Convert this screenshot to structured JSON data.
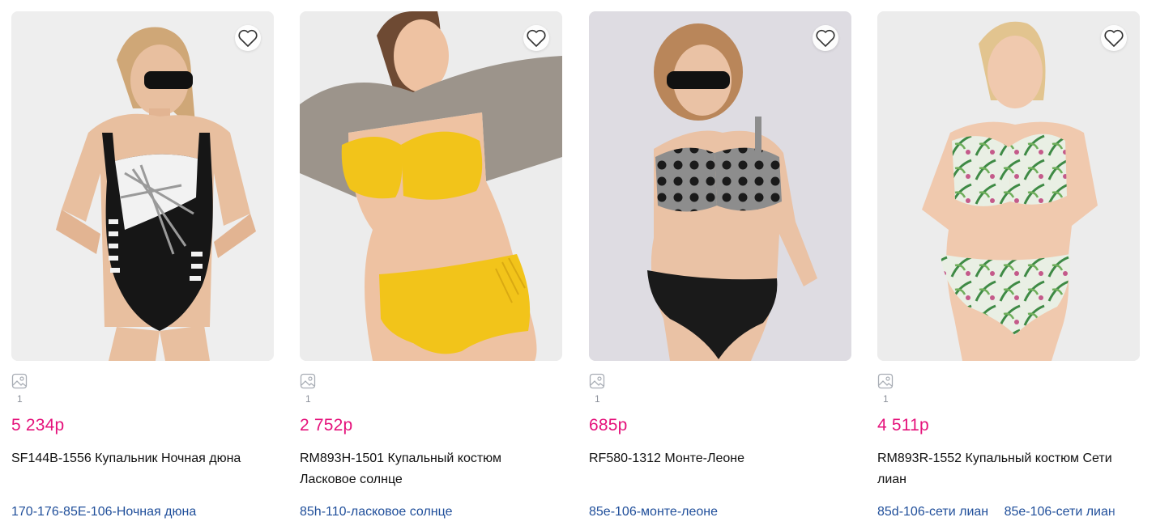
{
  "products": [
    {
      "media_count": "1",
      "price": "5 234р",
      "name": "SF144B-1556 Купальник Ночная дюна",
      "variants": [
        "170-176-85E-106-Ночная дюна"
      ],
      "colors": {
        "bg": "#eeeeee",
        "suit": "#161616",
        "accent": "#f2f2f2",
        "hair": "#cfa777",
        "skin": "#e8bf9f"
      },
      "style": "one-piece"
    },
    {
      "media_count": "1",
      "price": "2 752р",
      "name": "RM893H-1501 Купальный костюм Ласковое солнце",
      "variants": [
        "85h-110-ласковое солнце"
      ],
      "colors": {
        "bg": "#ececec",
        "suit": "#f2c41a",
        "accent": "#9c948b",
        "hair": "#6e4a33",
        "skin": "#eec2a2"
      },
      "style": "bikini-cardigan"
    },
    {
      "media_count": "1",
      "price": "685р",
      "name": "RF580-1312 Монте-Леоне",
      "variants": [
        "85e-106-монте-леоне"
      ],
      "colors": {
        "bg": "#dedce2",
        "suit": "#1a1a1a",
        "accent": "#8d8d8d",
        "hair": "#b9865a",
        "skin": "#eac2a5"
      },
      "style": "bikini-dots"
    },
    {
      "media_count": "1",
      "price": "4 511р",
      "name": "RM893R-1552 Купальный костюм Сети лиан",
      "variants": [
        "85d-106-сети лиан",
        "85e-106-сети лиан"
      ],
      "colors": {
        "bg": "#ececec",
        "suit": "#e9efe4",
        "accent": "#3e8a45",
        "hair": "#e2c48f",
        "skin": "#f0c9ae"
      },
      "style": "bikini-tropical"
    }
  ],
  "ui": {
    "price_color": "#e5127b",
    "link_color": "#1f4e9a",
    "favorite_icon": "heart-outline-icon",
    "media_icon": "image-icon"
  }
}
